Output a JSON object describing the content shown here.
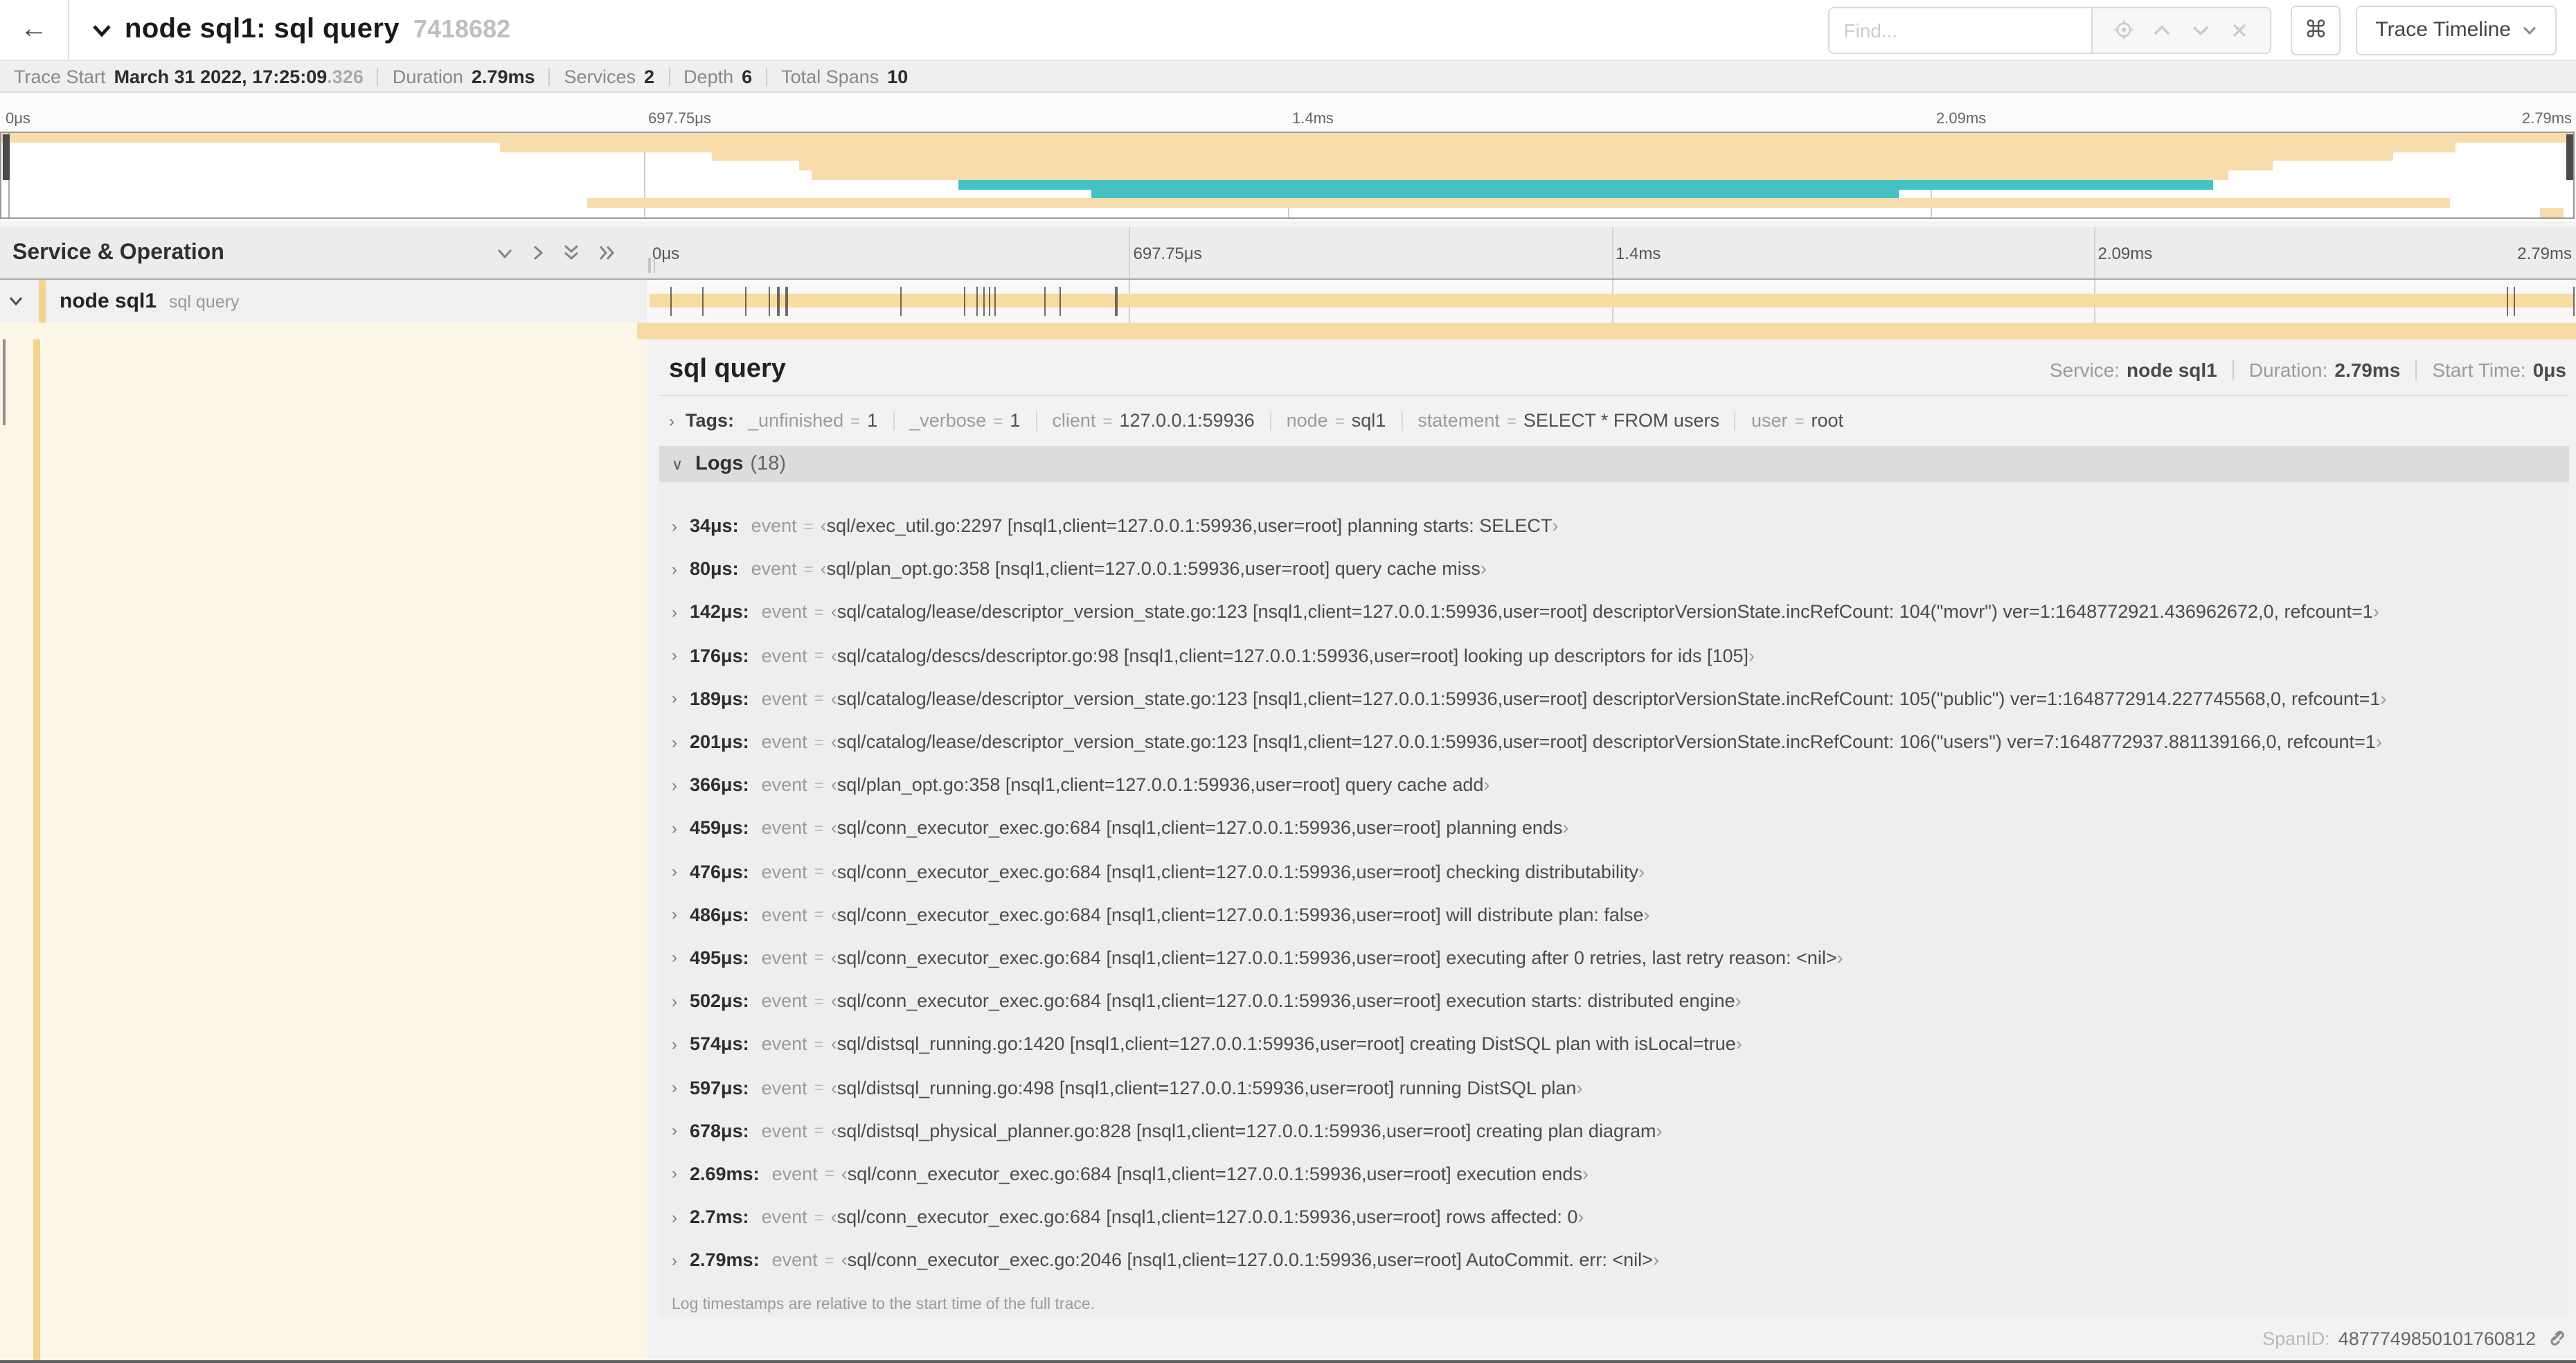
{
  "header": {
    "title": "node sql1: sql query",
    "trace_id": "7418682",
    "find_placeholder": "Find...",
    "trace_timeline_label": "Trace Timeline"
  },
  "icons": {
    "back": "←",
    "command": "⌘",
    "chevron_down": "∨",
    "chevron_right": "›"
  },
  "summary": {
    "items": [
      {
        "label": "Trace Start",
        "value": "March 31 2022, 17:25:09",
        "suffix": ".326"
      },
      {
        "label": "Duration",
        "value": "2.79ms"
      },
      {
        "label": "Services",
        "value": "2"
      },
      {
        "label": "Depth",
        "value": "6"
      },
      {
        "label": "Total Spans",
        "value": "10"
      }
    ]
  },
  "minimap": {
    "ticks": [
      "0μs",
      "697.75μs",
      "1.4ms",
      "2.09ms",
      "2.79ms"
    ],
    "spans": [
      {
        "start": 0,
        "end": 100,
        "color": "#f7ddab"
      },
      {
        "start": 19.4,
        "end": 95.4,
        "color": "#f7ddab"
      },
      {
        "start": 27.6,
        "end": 93.0,
        "color": "#f7ddab"
      },
      {
        "start": 31.0,
        "end": 88.3,
        "color": "#f7ddab"
      },
      {
        "start": 31.5,
        "end": 86.6,
        "color": "#f7ddab"
      },
      {
        "start": 37.2,
        "end": 86.0,
        "color": "#44c2c6"
      },
      {
        "start": 42.4,
        "end": 73.8,
        "color": "#44c2c6"
      },
      {
        "start": 22.8,
        "end": 95.2,
        "color": "#f7ddab"
      },
      {
        "start": 98.7,
        "end": 99.6,
        "color": "#f7ddab"
      }
    ]
  },
  "timeline": {
    "left_header": "Service & Operation",
    "ticks": [
      "0μs",
      "697.75μs",
      "1.4ms",
      "2.09ms",
      "2.79ms"
    ],
    "row": {
      "service": "node sql1",
      "operation": "sql query"
    },
    "log_marks_pct": [
      1.22,
      2.87,
      5.09,
      6.31,
      6.78,
      7.2,
      13.12,
      16.45,
      17.06,
      17.42,
      17.74,
      18.0,
      20.57,
      21.4,
      24.3,
      96.42,
      96.77,
      99.85
    ]
  },
  "detail": {
    "title": "sql query",
    "meta": [
      {
        "label": "Service:",
        "value": "node sql1"
      },
      {
        "label": "Duration:",
        "value": "2.79ms"
      },
      {
        "label": "Start Time:",
        "value": "0μs"
      }
    ],
    "tags_label": "Tags:",
    "eq": "=",
    "bracket_open": "‹",
    "bracket_close": "›",
    "tags": [
      {
        "key": "_unfinished",
        "value": "1"
      },
      {
        "key": "_verbose",
        "value": "1"
      },
      {
        "key": "client",
        "value": "127.0.0.1:59936"
      },
      {
        "key": "node",
        "value": "sql1"
      },
      {
        "key": "statement",
        "value": "SELECT * FROM users"
      },
      {
        "key": "user",
        "value": "root"
      }
    ],
    "logs_label": "Logs",
    "logs_count": "(18)",
    "log_key": "event",
    "logs": [
      {
        "time": "34μs:",
        "text": "sql/exec_util.go:2297 [nsql1,client=127.0.0.1:59936,user=root] planning starts: SELECT"
      },
      {
        "time": "80μs:",
        "text": "sql/plan_opt.go:358 [nsql1,client=127.0.0.1:59936,user=root] query cache miss"
      },
      {
        "time": "142μs:",
        "text": "sql/catalog/lease/descriptor_version_state.go:123 [nsql1,client=127.0.0.1:59936,user=root] descriptorVersionState.incRefCount: 104(\"movr\") ver=1:1648772921.436962672,0, refcount=1"
      },
      {
        "time": "176μs:",
        "text": "sql/catalog/descs/descriptor.go:98 [nsql1,client=127.0.0.1:59936,user=root] looking up descriptors for ids [105]"
      },
      {
        "time": "189μs:",
        "text": "sql/catalog/lease/descriptor_version_state.go:123 [nsql1,client=127.0.0.1:59936,user=root] descriptorVersionState.incRefCount: 105(\"public\") ver=1:1648772914.227745568,0, refcount=1"
      },
      {
        "time": "201μs:",
        "text": "sql/catalog/lease/descriptor_version_state.go:123 [nsql1,client=127.0.0.1:59936,user=root] descriptorVersionState.incRefCount: 106(\"users\") ver=7:1648772937.881139166,0, refcount=1"
      },
      {
        "time": "366μs:",
        "text": "sql/plan_opt.go:358 [nsql1,client=127.0.0.1:59936,user=root] query cache add"
      },
      {
        "time": "459μs:",
        "text": "sql/conn_executor_exec.go:684 [nsql1,client=127.0.0.1:59936,user=root] planning ends"
      },
      {
        "time": "476μs:",
        "text": "sql/conn_executor_exec.go:684 [nsql1,client=127.0.0.1:59936,user=root] checking distributability"
      },
      {
        "time": "486μs:",
        "text": "sql/conn_executor_exec.go:684 [nsql1,client=127.0.0.1:59936,user=root] will distribute plan: false"
      },
      {
        "time": "495μs:",
        "text": "sql/conn_executor_exec.go:684 [nsql1,client=127.0.0.1:59936,user=root] executing after 0 retries, last retry reason: <nil>"
      },
      {
        "time": "502μs:",
        "text": "sql/conn_executor_exec.go:684 [nsql1,client=127.0.0.1:59936,user=root] execution starts: distributed engine"
      },
      {
        "time": "574μs:",
        "text": "sql/distsql_running.go:1420 [nsql1,client=127.0.0.1:59936,user=root] creating DistSQL plan with isLocal=true"
      },
      {
        "time": "597μs:",
        "text": "sql/distsql_running.go:498 [nsql1,client=127.0.0.1:59936,user=root] running DistSQL plan"
      },
      {
        "time": "678μs:",
        "text": "sql/distsql_physical_planner.go:828 [nsql1,client=127.0.0.1:59936,user=root] creating plan diagram"
      },
      {
        "time": "2.69ms:",
        "text": "sql/conn_executor_exec.go:684 [nsql1,client=127.0.0.1:59936,user=root] execution ends"
      },
      {
        "time": "2.7ms:",
        "text": "sql/conn_executor_exec.go:684 [nsql1,client=127.0.0.1:59936,user=root] rows affected: 0"
      },
      {
        "time": "2.79ms:",
        "text": "sql/conn_executor_exec.go:2046 [nsql1,client=127.0.0.1:59936,user=root] AutoCommit. err: <nil>"
      }
    ],
    "footnote": "Log timestamps are relative to the start time of the full trace.",
    "spanid_label": "SpanID:",
    "spanid": "4877749850101760812"
  }
}
